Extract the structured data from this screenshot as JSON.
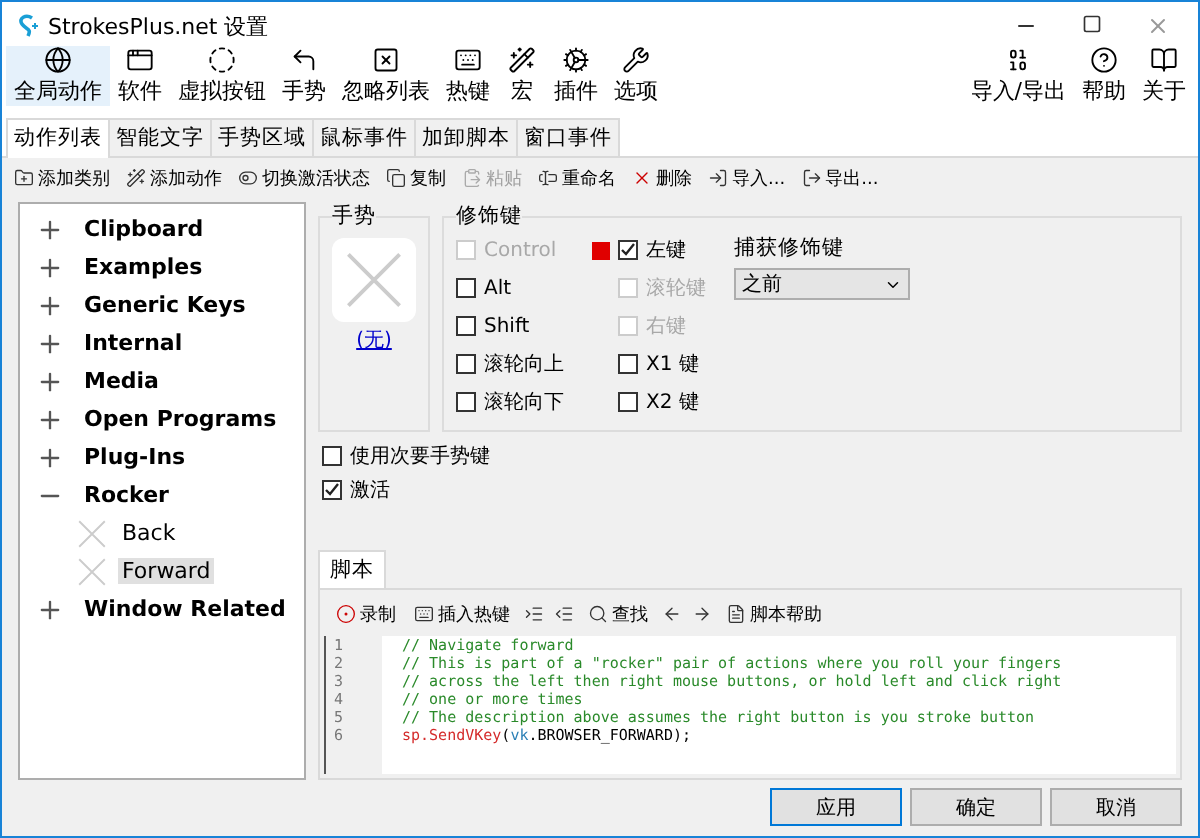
{
  "window": {
    "title": "StrokesPlus.net 设置"
  },
  "toolbar": {
    "left": [
      {
        "label": "全局动作",
        "selected": true
      },
      {
        "label": "软件",
        "selected": false
      },
      {
        "label": "虚拟按钮",
        "selected": false
      },
      {
        "label": "手势",
        "selected": false
      },
      {
        "label": "忽略列表",
        "selected": false
      },
      {
        "label": "热键",
        "selected": false
      },
      {
        "label": "宏",
        "selected": false
      },
      {
        "label": "插件",
        "selected": false
      },
      {
        "label": "选项",
        "selected": false
      }
    ],
    "right": [
      {
        "label": "导入/导出"
      },
      {
        "label": "帮助"
      },
      {
        "label": "关于"
      }
    ]
  },
  "tabs": [
    {
      "label": "动作列表",
      "selected": true
    },
    {
      "label": "智能文字",
      "selected": false
    },
    {
      "label": "手势区域",
      "selected": false
    },
    {
      "label": "鼠标事件",
      "selected": false
    },
    {
      "label": "加卸脚本",
      "selected": false
    },
    {
      "label": "窗口事件",
      "selected": false
    }
  ],
  "actions": [
    {
      "label": "添加类别",
      "disabled": false
    },
    {
      "label": "添加动作",
      "disabled": false
    },
    {
      "label": "切换激活状态",
      "disabled": false
    },
    {
      "label": "复制",
      "disabled": false
    },
    {
      "label": "粘贴",
      "disabled": true
    },
    {
      "label": "重命名",
      "disabled": false
    },
    {
      "label": "删除",
      "disabled": false
    },
    {
      "label": "导入...",
      "disabled": false
    },
    {
      "label": "导出...",
      "disabled": false
    }
  ],
  "tree": [
    {
      "label": "Clipboard",
      "expanded": false
    },
    {
      "label": "Examples",
      "expanded": false
    },
    {
      "label": "Generic Keys",
      "expanded": false
    },
    {
      "label": "Internal",
      "expanded": false
    },
    {
      "label": "Media",
      "expanded": false
    },
    {
      "label": "Open Programs",
      "expanded": false
    },
    {
      "label": "Plug-Ins",
      "expanded": false
    },
    {
      "label": "Rocker",
      "expanded": true,
      "children": [
        {
          "label": "Back",
          "selected": false
        },
        {
          "label": "Forward",
          "selected": true
        }
      ]
    },
    {
      "label": "Window Related",
      "expanded": false
    }
  ],
  "gesture": {
    "heading": "手势",
    "link": "(无)"
  },
  "modifiers": {
    "heading": "修饰键",
    "left_column": [
      {
        "label": "Control",
        "checked": false,
        "disabled": true
      },
      {
        "label": "Alt",
        "checked": false,
        "disabled": false
      },
      {
        "label": "Shift",
        "checked": false,
        "disabled": false
      },
      {
        "label": "滚轮向上",
        "checked": false,
        "disabled": false
      },
      {
        "label": "滚轮向下",
        "checked": false,
        "disabled": false
      }
    ],
    "right_column": [
      {
        "label": "左键",
        "checked": true,
        "disabled": false,
        "stroke_button": true
      },
      {
        "label": "滚轮键",
        "checked": false,
        "disabled": true,
        "stroke_button": false
      },
      {
        "label": "右键",
        "checked": false,
        "disabled": true,
        "stroke_button": false
      },
      {
        "label": "X1 键",
        "checked": false,
        "disabled": false,
        "stroke_button": false
      },
      {
        "label": "X2 键",
        "checked": false,
        "disabled": false,
        "stroke_button": false
      }
    ],
    "capture": {
      "label": "捕获修饰键",
      "value": "之前"
    }
  },
  "options": [
    {
      "label": "使用次要手势键",
      "checked": false
    },
    {
      "label": "激活",
      "checked": true
    }
  ],
  "script": {
    "tab": "脚本",
    "tools": [
      {
        "kind": "button",
        "label": "录制"
      },
      {
        "kind": "button",
        "label": "插入热键"
      },
      {
        "kind": "icon"
      },
      {
        "kind": "icon"
      },
      {
        "kind": "button",
        "label": "查找"
      },
      {
        "kind": "icon"
      },
      {
        "kind": "icon"
      },
      {
        "kind": "button",
        "label": "脚本帮助"
      }
    ],
    "lines": [
      {
        "number": "1",
        "segments": [
          {
            "kind": "comment",
            "text": "// Navigate forward"
          }
        ]
      },
      {
        "number": "2",
        "segments": [
          {
            "kind": "comment",
            "text": "// This is part of a \"rocker\" pair of actions where you roll your fingers"
          }
        ]
      },
      {
        "number": "3",
        "segments": [
          {
            "kind": "comment",
            "text": "// across the left then right mouse buttons, or hold left and click right"
          }
        ]
      },
      {
        "number": "4",
        "segments": [
          {
            "kind": "comment",
            "text": "// one or more times"
          }
        ]
      },
      {
        "number": "5",
        "segments": [
          {
            "kind": "comment",
            "text": "// The description above assumes the right button is you stroke button"
          }
        ]
      },
      {
        "number": "6",
        "segments": [
          {
            "kind": "call",
            "text": "sp.SendVKey"
          },
          {
            "kind": "plain",
            "text": "("
          },
          {
            "kind": "object",
            "text": "vk"
          },
          {
            "kind": "plain",
            "text": ".BROWSER_FORWARD);"
          }
        ]
      }
    ]
  },
  "buttons": [
    {
      "label": "应用",
      "default": true
    },
    {
      "label": "确定",
      "default": false
    },
    {
      "label": "取消",
      "default": false
    }
  ]
}
